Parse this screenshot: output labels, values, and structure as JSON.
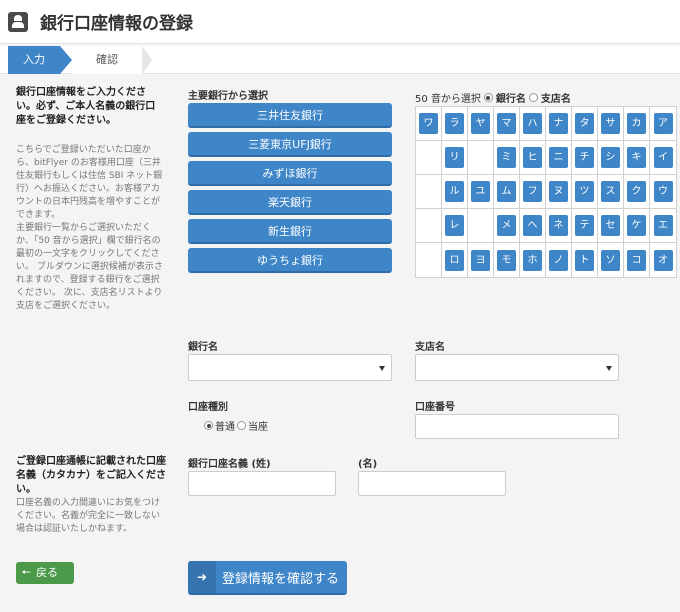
{
  "header": {
    "title": "銀行口座情報の登録"
  },
  "steps": {
    "input": "入力",
    "confirm": "確認"
  },
  "guide1": {
    "title": "銀行口座情報をご入力ください。必ず、ご本人名義の銀行口座をご登録ください。",
    "text1": "こちらでご登録いただいた口座から、bitFlyer のお客様用口座（三井住友銀行もしくは住信 SBI ネット銀行）へお振込ください。お客様アカウントの日本円残高を増やすことができます。",
    "text2": "主要銀行一覧からご選択いただくか、「50 音から選択」欄で銀行名の最初の一文字をクリックしてください。 プルダウンに選択候補が表示されますので、登録する銀行をご選択ください。 次に、支店名リストより支店をご選択ください。"
  },
  "main_banks": {
    "label": "主要銀行から選択",
    "items": [
      "三井住友銀行",
      "三菱東京UFJ銀行",
      "みずほ銀行",
      "楽天銀行",
      "新生銀行",
      "ゆうちょ銀行"
    ]
  },
  "kana": {
    "label": "50 音から選択",
    "opt_bank": "銀行名",
    "opt_branch": "支店名",
    "rows": [
      [
        "ワ",
        "ラ",
        "ヤ",
        "マ",
        "ハ",
        "ナ",
        "タ",
        "サ",
        "カ",
        "ア"
      ],
      [
        "",
        "リ",
        "",
        "ミ",
        "ヒ",
        "ニ",
        "チ",
        "シ",
        "キ",
        "イ"
      ],
      [
        "",
        "ル",
        "ユ",
        "ム",
        "フ",
        "ヌ",
        "ツ",
        "ス",
        "ク",
        "ウ"
      ],
      [
        "",
        "レ",
        "",
        "メ",
        "ヘ",
        "ネ",
        "テ",
        "セ",
        "ケ",
        "エ"
      ],
      [
        "",
        "ロ",
        "ヨ",
        "モ",
        "ホ",
        "ノ",
        "ト",
        "ソ",
        "コ",
        "オ"
      ]
    ]
  },
  "form": {
    "bank_name_label": "銀行名",
    "branch_name_label": "支店名",
    "account_type_label": "口座種別",
    "account_type_ordinary": "普通",
    "account_type_current": "当座",
    "account_number_label": "口座番号",
    "holder_last_label": "銀行口座名義 (姓)",
    "holder_first_label": "(名)"
  },
  "guide2": {
    "title": "ご登録口座通帳に記載された口座名義（カタカナ）をご記入ください。",
    "text": "口座名義の入力間違いにお気をつけください。名義が完全に一致しない場合は認証いたしかねます。"
  },
  "buttons": {
    "back": "戻る",
    "confirm": "登録情報を確認する"
  },
  "colors": {
    "primary": "#3f86c9",
    "back_button": "#4a9a4a"
  }
}
